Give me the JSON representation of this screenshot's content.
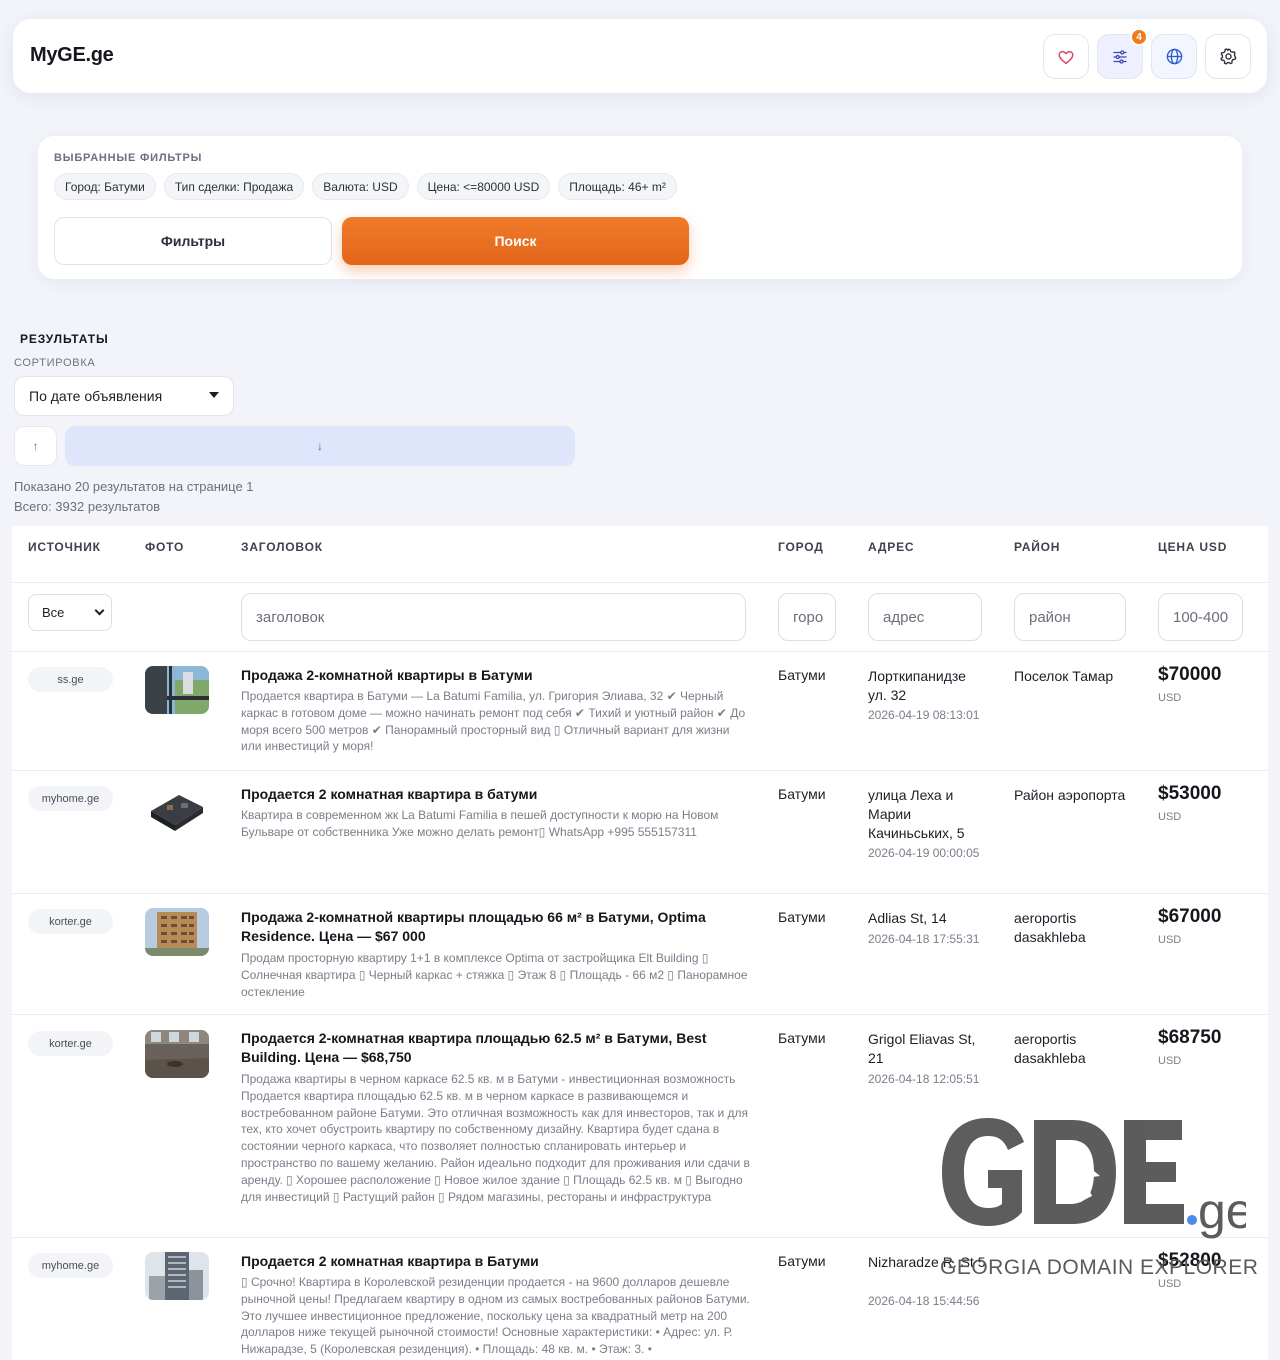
{
  "header": {
    "brand": "MyGE.ge",
    "filter_badge": "4",
    "icons": [
      "heart-icon",
      "sliders-icon",
      "globe-icon",
      "gear-icon"
    ]
  },
  "filters": {
    "title": "ВЫБРАННЫЕ ФИЛЬТРЫ",
    "chips": [
      "Город: Батуми",
      "Тип сделки: Продажа",
      "Валюта: USD",
      "Цена: <=80000 USD",
      "Площадь: 46+ m²"
    ],
    "filters_button": "Фильтры",
    "search_button": "Поиск"
  },
  "results": {
    "title": "РЕЗУЛЬТАТЫ",
    "sort_label": "СОРТИРОВКА",
    "sort_value": "По дате объявления",
    "asc_label": "↑",
    "desc_label": "↓",
    "shown_text": "Показано 20 результатов на странице 1",
    "total_text": "Всего: 3932 результатов"
  },
  "table": {
    "headers": {
      "source": "ИСТОЧНИК",
      "photo": "ФОТО",
      "title": "ЗАГОЛОВОК",
      "city": "ГОРОД",
      "address": "АДРЕС",
      "district": "РАЙОН",
      "price": "ЦЕНА USD"
    },
    "filter_row": {
      "source_value": "Все",
      "title_placeholder": "заголовок",
      "city_placeholder": "горо",
      "address_placeholder": "адрес",
      "district_placeholder": "район",
      "price_placeholder": "100-400"
    },
    "rows": [
      {
        "source": "ss.ge",
        "title": "Продажа 2-комнатной квартиры в Батуми",
        "description": "Продается квартира в Батуми — La Batumi Familia, ул. Григория Элиава, 32 ✔ Черный каркас в готовом доме — можно начинать ремонт под себя ✔ Тихий и уютный район ✔ До моря всего 500 метров ✔ Панорамный просторный вид ▯ Отличный вариант для жизни или инвестиций у моря!",
        "city": "Батуми",
        "address": "Лорткипанидзе ул. 32",
        "date": "2026-04-19 08:13:01",
        "district": "Поселок Тамар",
        "price": "$70000",
        "currency": "USD"
      },
      {
        "source": "myhome.ge",
        "title": "Продается 2 комнатная квартира в батуми",
        "description": "Квартира в современном жк La Batumi Familia в пешей доступности к морю на Новом Бульваре от собственника Уже можно делать ремонт▯ WhatsApp +995 555157311",
        "city": "Батуми",
        "address": "улица Леха и Марии Качиньських, 5",
        "date": "2026-04-19 00:00:05",
        "district": "Район аэропорта",
        "price": "$53000",
        "currency": "USD"
      },
      {
        "source": "korter.ge",
        "title": "Продажа 2-комнатной квартиры площадью 66 м² в Батуми, Optima Residence. Цена — $67 000",
        "description": "Продам просторную квартиру 1+1 в комплексе Optima от застройщика Elt Building ▯ Солнечная квартира ▯ Черный каркас + стяжка ▯ Этаж 8 ▯ Площадь - 66 м2 ▯ Панорамное остекление",
        "city": "Батуми",
        "address": "Adlias St, 14",
        "date": "2026-04-18 17:55:31",
        "district": "aeroportis dasakhleba",
        "price": "$67000",
        "currency": "USD"
      },
      {
        "source": "korter.ge",
        "title": "Продается 2-комнатная квартира площадью 62.5 м² в Батуми, Best Building. Цена — $68,750",
        "description": "Продажа квартиры в черном каркасе 62.5 кв. м в Батуми - инвестиционная возможность Продается квартира площадью 62.5 кв. м в черном каркасе в развивающемся и востребованном районе Батуми. Это отличная возможность как для инвесторов, так и для тех, кто хочет обустроить квартиру по собственному дизайну. Квартира будет сдана в состоянии черного каркаса, что позволяет полностью спланировать интерьер и пространство по вашему желанию. Район идеально подходит для проживания или сдачи в аренду. ▯ Хорошее расположение ▯ Новое жилое здание ▯ Площадь 62.5 кв. м ▯ Выгодно для инвестиций ▯ Растущий район ▯ Рядом магазины, рестораны и инфраструктура",
        "city": "Батуми",
        "address": "Grigol Eliavas St, 21",
        "date": "2026-04-18 12:05:51",
        "district": "aeroportis dasakhleba",
        "price": "$68750",
        "currency": "USD"
      },
      {
        "source": "myhome.ge",
        "title": "Продается 2 комнатная квартира в Батуми",
        "description": "▯ Срочно! Квартира в Королевской резиденции продается - на 9600 долларов дешевле рыночной цены! Предлагаем квартиру в одном из самых востребованных районов Батуми. Это лучшее инвестиционное предложение, поскольку цена за квадратный метр на 200 долларов ниже текущей рыночной стоимости! Основные характеристики: • Адрес: ул. Р. Нижарадзе, 5 (Королевская резиденция). • Площадь: 48 кв. м. • Этаж: 3. •",
        "city": "Батуми",
        "address": "Nizharadze R. St 5",
        "date": "2026-04-18 15:44:56",
        "district": "",
        "price": "$52800",
        "currency": "USD"
      }
    ]
  },
  "watermark": {
    "logo_text": "GDE.ge",
    "tagline": "GEORGIA DOMAIN EXPLORER"
  }
}
